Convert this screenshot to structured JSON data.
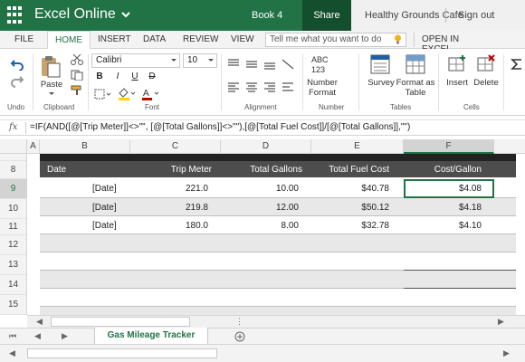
{
  "titlebar": {
    "app_name": "Excel Online",
    "workbook": "Book 4",
    "share_label": "Share",
    "user": "Healthy Grounds Cafe",
    "signout_label": "Sign out"
  },
  "tabs": [
    "FILE",
    "HOME",
    "INSERT",
    "DATA",
    "REVIEW",
    "VIEW"
  ],
  "active_tab": "HOME",
  "tell_me": {
    "placeholder": "Tell me what you want to do"
  },
  "open_in_excel": "OPEN IN EXCEL",
  "ribbon": {
    "groups": {
      "undo": "Undo",
      "clipboard": "Clipboard",
      "font": "Font",
      "alignment": "Alignment",
      "number": "Number",
      "tables": "Tables",
      "cells": "Cells"
    },
    "paste_label": "Paste",
    "font_name": "Calibri",
    "font_size": "10",
    "bold": "B",
    "italic": "I",
    "underline": "U",
    "strike": "D",
    "number_icon_text": "ABC\n123",
    "number_format_label": "Number Format",
    "survey_label": "Survey",
    "format_as_table_label": "Format as Table",
    "insert_label": "Insert",
    "delete_label": "Delete"
  },
  "formula_bar": {
    "fx": "fx",
    "formula": "=IF(AND([@[Trip Meter]]<>\"\", [@[Total Gallons]]<>\"\"),[@[Total Fuel Cost]]/[@[Total Gallons]],\"\")"
  },
  "columns": [
    "A",
    "B",
    "C",
    "D",
    "E",
    "F"
  ],
  "selected_column": "F",
  "row_numbers": [
    "8",
    "9",
    "10",
    "11",
    "12",
    "13",
    "14",
    "15"
  ],
  "selected_row": "9",
  "table": {
    "headers": [
      "Date",
      "Trip Meter",
      "Total Gallons",
      "Total Fuel Cost",
      "Cost/Gallon"
    ],
    "rows": [
      [
        "[Date]",
        "221.0",
        "10.00",
        "$40.78",
        "$4.08"
      ],
      [
        "[Date]",
        "219.8",
        "12.00",
        "$50.12",
        "$4.18"
      ],
      [
        "[Date]",
        "180.0",
        "8.00",
        "$32.78",
        "$4.10"
      ]
    ]
  },
  "sheet_tab": "Gas Mileage Tracker",
  "colors": {
    "brand": "#217346",
    "brand_dark": "#134f2c",
    "table_header": "#4d4d4d",
    "row_band": "#e8e8e8"
  }
}
